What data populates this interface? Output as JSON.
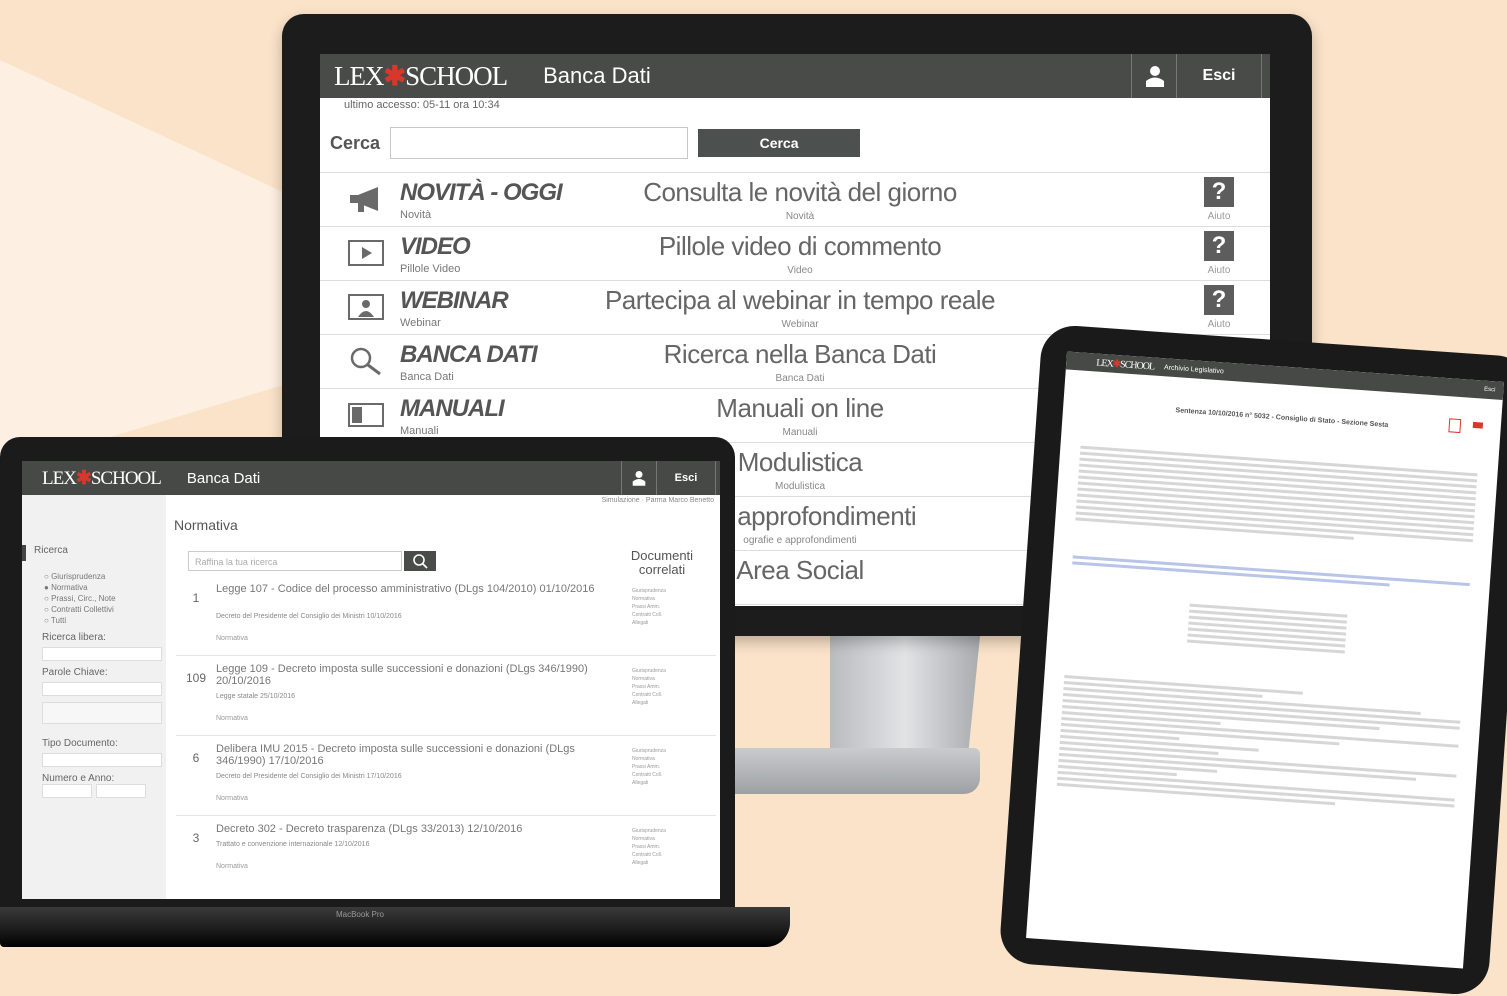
{
  "desktop": {
    "logo": "LEX",
    "logo_mark": "✱",
    "logo_rest": "SCHOOL",
    "title": "Banca Dati",
    "exit_label": "Esci",
    "last_access": "ultimo accesso: 05-11 ora 10:34",
    "search_label": "Cerca",
    "search_value": "",
    "search_button": "Cerca",
    "menu": [
      {
        "title": "NOVITÀ - OGGI",
        "sub": "Novità",
        "desc": "Consulta le novità del giorno",
        "desc_sub": "Novità",
        "icon": "megaphone-icon",
        "help": "?",
        "help_label": "Aiuto"
      },
      {
        "title": "VIDEO",
        "sub": "Pillole Video",
        "desc": "Pillole video di commento",
        "desc_sub": "Video",
        "icon": "play-icon",
        "help": "?",
        "help_label": "Aiuto"
      },
      {
        "title": "WEBINAR",
        "sub": "Webinar",
        "desc": "Partecipa al webinar in tempo reale",
        "desc_sub": "Webinar",
        "icon": "presenter-icon",
        "help": "?",
        "help_label": "Aiuto"
      },
      {
        "title": "BANCA DATI",
        "sub": "Banca Dati",
        "desc": "Ricerca nella Banca Dati",
        "desc_sub": "Banca Dati",
        "icon": "magnifier-icon"
      },
      {
        "title": "MANUALI",
        "sub": "Manuali",
        "desc": "Manuali on line",
        "desc_sub": "Manuali",
        "icon": "book-icon"
      },
      {
        "title": "",
        "sub": "",
        "desc": "Modulistica",
        "desc_sub": "Modulistica",
        "icon": ""
      },
      {
        "title": "",
        "sub": "",
        "desc": "fie e approfondimenti",
        "desc_sub": "ografie e approfondimenti",
        "icon": ""
      },
      {
        "title": "",
        "sub": "",
        "desc": "Area Social",
        "desc_sub": "",
        "icon": ""
      }
    ]
  },
  "laptop": {
    "logo": "LEX",
    "logo_mark": "✱",
    "logo_rest": "SCHOOL",
    "title": "Banca Dati",
    "exit_label": "Esci",
    "breadcrumb": "Simulazione · Parma Marco Benetto",
    "heading": "Normativa",
    "search_placeholder": "Raffina la tua ricerca",
    "sidebar_active": "Ricerca",
    "sidebar_options": [
      "Giurisprudenza",
      "Normativa",
      "Prassi, Circ., Note",
      "Contratti Collettivi",
      "Tutti"
    ],
    "label_free": "Ricerca libera:",
    "label_keywords": "Parole Chiave:",
    "label_doctype": "Tipo Documento:",
    "label_number_year": "Numero e Anno:",
    "docs_heading": "Documenti correlati",
    "related": [
      "Giurisprudenza",
      "Normativa",
      "Prassi Amm.",
      "Contratti Coll.",
      "Allegati"
    ],
    "results": [
      {
        "num": "1",
        "title": "Legge 107 - Codice del processo amministrativo (DLgs 104/2010) 01/10/2016",
        "sub": "Decreto del Presidente del Consiglio dei Ministri 10/10/2016",
        "tag": "Normativa"
      },
      {
        "num": "109",
        "title": "Legge 109 - Decreto imposta sulle successioni e donazioni (DLgs 346/1990) 20/10/2016",
        "sub": "Legge statale 25/10/2016",
        "tag": "Normativa"
      },
      {
        "num": "6",
        "title": "Delibera IMU 2015 - Decreto imposta sulle successioni e donazioni (DLgs 346/1990) 17/10/2016",
        "sub": "Decreto del Presidente del Consiglio dei Ministri 17/10/2016",
        "tag": "Normativa"
      },
      {
        "num": "3",
        "title": "Decreto 302 - Decreto trasparenza (DLgs 33/2013) 12/10/2016",
        "sub": "Trattato e convenzione internazionale 12/10/2016",
        "tag": "Normativa"
      }
    ],
    "model_label": "MacBook Pro"
  },
  "tablet": {
    "logo": "LEX",
    "logo_mark": "✱",
    "logo_rest": "SCHOOL",
    "title": "Archivio Legislativo",
    "exit_label": "Esci",
    "doc_title": "Sentenza 10/10/2016 n° 5032 - Consiglio di Stato - Sezione Sesta"
  },
  "colors": {
    "bar": "#494b49",
    "accent": "#d8382b",
    "background": "#fbe3c9"
  }
}
